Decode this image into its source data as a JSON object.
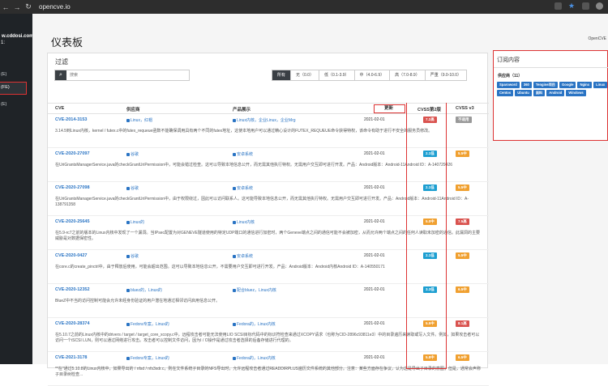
{
  "browser": {
    "url": "opencve.io"
  },
  "sidebar": {
    "user": "w.cddosi.com",
    "sub": "1:",
    "items": [
      {
        "label": "(E)"
      },
      {
        "label": "(FE)"
      },
      {
        "label": "(E)"
      }
    ]
  },
  "header": {
    "title": "仪表板",
    "right": "OpenCVE"
  },
  "filter": {
    "title": "过滤",
    "search_placeholder": "搜索",
    "buttons": [
      "所有",
      "无（0.0）",
      "低（0.1-3.9）",
      "中（4.0-6.9）",
      "高（7.0-8.9）",
      "严重（9.0-10.0）"
    ]
  },
  "table": {
    "headers": {
      "cve": "CVE",
      "vendor": "供应商",
      "product": "产品展示",
      "updated": "更新",
      "v2": "CVSS第2版",
      "v3": "CVSS v3"
    },
    "rows": [
      {
        "cve": "CVE-2014-3153",
        "vendor": "Linux，红帽",
        "product": "Linux内核，企业Linux，企业Mrg",
        "date": "2021-02-01",
        "v2": "7.2高",
        "v2_color": "#d9534f",
        "v3": "不适用",
        "v3_color": "#999999",
        "desc": "3.14.5到Linux内核，kernel / futex.c中的futex_requeue函数不能确保调用具有两个不同的futex地址，这使本地用户可以通过精心设计的FUTEX_REQUEUE命令获得特权，该命令有助于进行不安全的服务员修改。"
      },
      {
        "cve": "CVE-2020-27097",
        "vendor": "谷歌",
        "product": "安卓系统",
        "date": "2021-02-01",
        "v2": "2.1低",
        "v2_color": "#1e9fd1",
        "v3": "5.5中",
        "v3_color": "#f0a030",
        "desc": "在UriGrantsManagerService.java的checkGrantUriPermission中，可能会错过检查。这可以导致本地信息公开，而无需其他执行特权。无需用户交互即可进行开发。产品：Android版本：Android-11Android ID：A-140729426"
      },
      {
        "cve": "CVE-2020-27098",
        "vendor": "谷歌",
        "product": "安卓系统",
        "date": "2021-02-01",
        "v2": "2.1低",
        "v2_color": "#1e9fd1",
        "v3": "5.5中",
        "v3_color": "#f0a030",
        "desc": "在UriGrantsManagerService.java的checkGrantUriPermission中，由于权限绕过，因此可以访问联系人。这可能导致本地信息公开，而无需其他执行特权。无需用户交互即可进行开发。产品：Android版本：Android-11Android ID：A-138791358"
      },
      {
        "cve": "CVE-2020-25645",
        "vendor": "Linux的",
        "product": "Linux内核",
        "date": "2021-02-01",
        "v2": "5.0中",
        "v2_color": "#f0a030",
        "v3": "7.5高",
        "v3_color": "#d9534f",
        "desc": "在5.9-rc7之前的版本的Linux内核中发现了一个漏洞。当IPsec配置为对GENEVE隧道使用的特定UDP端口的通信进行加密时，两个Geneve端点之间的通信可能不会被加密，从而允许两个端点之间的任何人读取未加密的通信。此漏洞的主要威胁是对数据保密性。"
      },
      {
        "cve": "CVE-2020-0427",
        "vendor": "谷歌",
        "product": "安卓系统",
        "date": "2021-02-01",
        "v2": "2.1低",
        "v2_color": "#1e9fd1",
        "v3": "5.5中",
        "v3_color": "#f0a030",
        "desc": "在core.c的create_pinctrl中，由于释放后使用，可能会超出范围。这可以导致本地信息公开，不需要用户交互即可进行开发。产品：Android版本：Android内核Android ID：A-140550171"
      },
      {
        "cve": "CVE-2020-12352",
        "vendor": "bluez的，Linux的",
        "product": "配合bluez，Linux内核",
        "date": "2021-02-01",
        "v2": "3.3低",
        "v2_color": "#1e9fd1",
        "v3": "6.5中",
        "v3_color": "#f0a030",
        "desc": "BlueZ中不当的访问控制可能会允许未经身份验证的用户潜在地通过相邻访问启用信息公开。"
      },
      {
        "cve": "CVE-2020-28374",
        "vendor": "Fedora专案，Linux的",
        "product": "Fedora的，Linux内核",
        "date": "2021-02-01",
        "v2": "5.5中",
        "v2_color": "#f0a030",
        "v3": "8.1高",
        "v3_color": "#d9534f",
        "desc": "在5.10.7之前的Linux内核中的drivers / target / target_core_xcopy.c中，远程攻击者可能无法使用LIO SCSI目标代码中的标识符检查来通过XCOPY请求（也称为CID-2896c93811e3）中的目录遍历来读取或写入文件。例如，如果攻击者可以访问一个iSCSI LUN，则可以通过网络进行攻击。攻击者可以控制文件访问，因为I / O操作是通过攻击者选择的后备存储进行代理的。"
      },
      {
        "cve": "CVE-2021-3178",
        "vendor": "Fedora专案，Linux的",
        "product": "Fedora的，Linux内核",
        "date": "2021-02-01",
        "v2": "5.8中",
        "v2_color": "#f0a030",
        "v3": "6.5中",
        "v3_color": "#f0a030",
        "desc": "**在\"通过5.10.8的Linux内核中，如果导出的 / nfsd / nfs3xdr.c，则在文件系统子目录的NFS导出时，允许远程攻击者通过READDIRPLUS遍历文件系统的其他部分。注意：某些方面存在争议，认为这是导出子目录的意图；但是，通常会声称子目录树检查..."
      }
    ]
  },
  "subscription": {
    "title": "订阅内容",
    "vendors_label": "供应商（11）",
    "tags": [
      "Sparoword",
      "360",
      "Tengine项目",
      "Google",
      "Nginx",
      "Linux",
      "Centos",
      "Ubuntu",
      "面料",
      "Android",
      "Windows"
    ]
  }
}
